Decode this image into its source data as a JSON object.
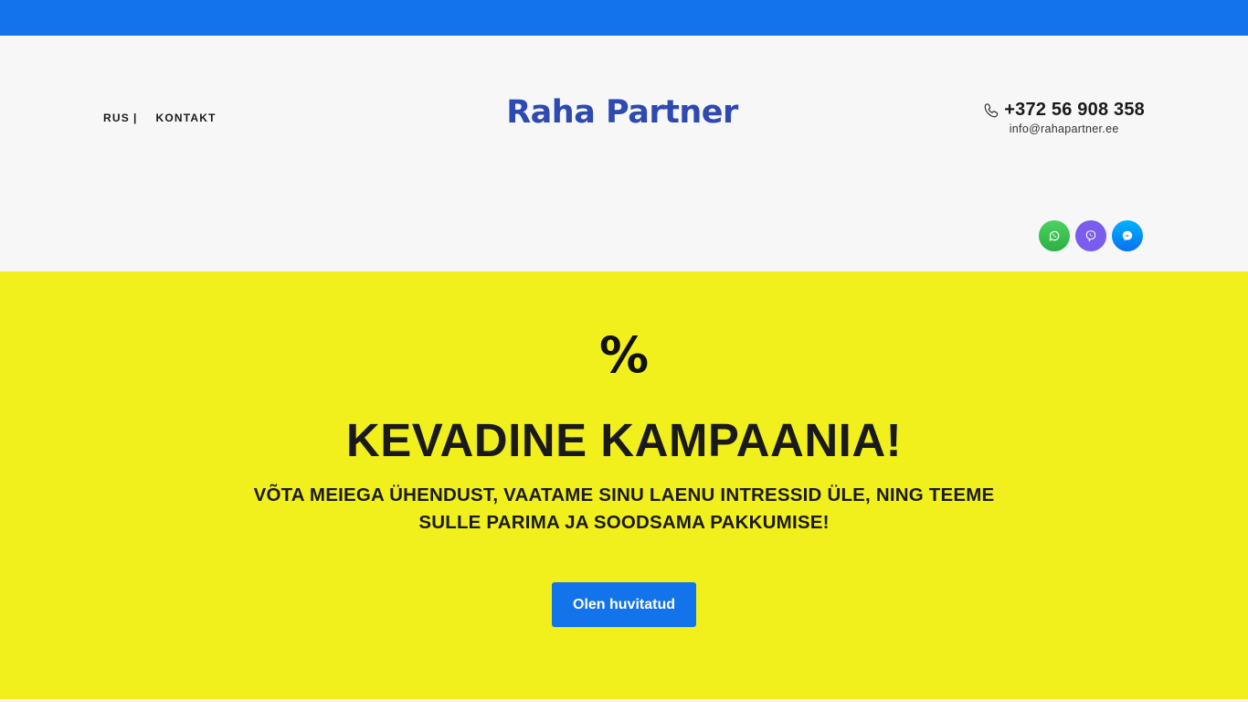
{
  "nav": {
    "lang_label": "RUS",
    "separator": "|",
    "contact_label": "KONTAKT"
  },
  "header": {
    "logo": "Raha Partner",
    "phone": "+372 56 908 358",
    "email": "info@rahapartner.ee",
    "icons": [
      "phone-icon",
      "whatsapp-icon",
      "viber-icon",
      "messenger-icon"
    ]
  },
  "hero": {
    "symbol": "%",
    "title": "KEVADINE KAMPAANIA!",
    "subtitle": "VÕTA MEIEGA ÜHENDUST, VAATAME SINU LAENU INTRESSID ÜLE, NING TEEME SULLE PARIMA JA SOODSAMA PAKKUMISE!",
    "cta_label": "Olen huvitatud"
  },
  "colors": {
    "topbar": "#1273eb",
    "logo": "#2e4ab1",
    "hero_bg": "#f2f01c",
    "cta_bg": "#1273eb",
    "whatsapp": "#2bb043",
    "viber": "#7a5ded",
    "messenger": "#0a70f0"
  }
}
